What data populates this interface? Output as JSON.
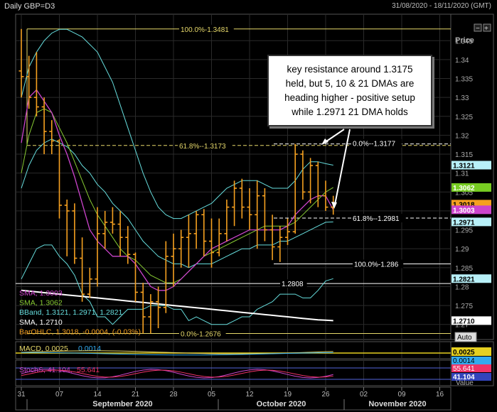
{
  "header": {
    "title": "Daily GBP=D3",
    "date_range": "31/08/2020 - 18/11/2020 (GMT)"
  },
  "toolbar": {
    "collapse_label": "−",
    "expand_label": "+",
    "auto_label": "Auto"
  },
  "colors": {
    "bar": "#f5a020",
    "sma5": "#cc44cc",
    "sma10": "#88cc33",
    "bband": "#66dddd",
    "sma_white": "#ffffff",
    "fib": "#e6d86a",
    "grid": "#2a2a2a",
    "bg": "#000000"
  },
  "annotation": {
    "lines": [
      "key resistance around 1.3175",
      "held, but 5, 10 & 21 DMAs are",
      "heading higher - positive setup",
      "while 1.2971 21 DMA holds"
    ]
  },
  "fib_labels": {
    "f100": "100.0%-1.3481",
    "f618": "61.8%--1.3173",
    "f0": "0.0%-1.2676",
    "r0": "0.0%--1.3177",
    "r618": "61.8%--1.2981",
    "r100": "100.0%-1.286",
    "support": "1.2808"
  },
  "chart_data": [
    {
      "type": "ohlc",
      "title": "Daily GBP=D3",
      "ylabel": "Price",
      "ylim": [
        1.266,
        1.352
      ],
      "yticks": [
        "1.345",
        "1.34",
        "1.335",
        "1.33",
        "1.325",
        "1.32",
        "1.315",
        "1.31",
        "1.305",
        "1.3",
        "1.295",
        "1.29",
        "1.285",
        "1.28",
        "1.275",
        "1.27"
      ],
      "xticks": [
        "31",
        "07",
        "14",
        "21",
        "28",
        "05",
        "12",
        "19",
        "26",
        "02",
        "09",
        "16"
      ],
      "months": [
        "September 2020",
        "October 2020",
        "November 2020"
      ],
      "ohlc": [
        {
          "o": 1.337,
          "h": 1.3481,
          "l": 1.33,
          "c": 1.3355
        },
        {
          "o": 1.3355,
          "h": 1.341,
          "l": 1.327,
          "c": 1.33
        },
        {
          "o": 1.33,
          "h": 1.342,
          "l": 1.325,
          "c": 1.3275
        },
        {
          "o": 1.3275,
          "h": 1.33,
          "l": 1.315,
          "c": 1.321
        },
        {
          "o": 1.321,
          "h": 1.324,
          "l": 1.315,
          "c": 1.3185
        },
        {
          "o": 1.3185,
          "h": 1.319,
          "l": 1.298,
          "c": 1.3015
        },
        {
          "o": 1.3015,
          "h": 1.303,
          "l": 1.288,
          "c": 1.3
        },
        {
          "o": 1.3,
          "h": 1.302,
          "l": 1.286,
          "c": 1.2875
        },
        {
          "o": 1.2875,
          "h": 1.293,
          "l": 1.276,
          "c": 1.278
        },
        {
          "o": 1.278,
          "h": 1.285,
          "l": 1.277,
          "c": 1.282
        },
        {
          "o": 1.282,
          "h": 1.301,
          "l": 1.28,
          "c": 1.294
        },
        {
          "o": 1.294,
          "h": 1.3,
          "l": 1.29,
          "c": 1.297
        },
        {
          "o": 1.297,
          "h": 1.301,
          "l": 1.294,
          "c": 1.2965
        },
        {
          "o": 1.2965,
          "h": 1.3,
          "l": 1.288,
          "c": 1.293
        },
        {
          "o": 1.293,
          "h": 1.296,
          "l": 1.286,
          "c": 1.2885
        },
        {
          "o": 1.2885,
          "h": 1.289,
          "l": 1.276,
          "c": 1.2785
        },
        {
          "o": 1.2785,
          "h": 1.281,
          "l": 1.2676,
          "c": 1.272
        },
        {
          "o": 1.272,
          "h": 1.278,
          "l": 1.2676,
          "c": 1.276
        },
        {
          "o": 1.276,
          "h": 1.28,
          "l": 1.269,
          "c": 1.2745
        },
        {
          "o": 1.2745,
          "h": 1.292,
          "l": 1.273,
          "c": 1.288
        },
        {
          "o": 1.288,
          "h": 1.294,
          "l": 1.28,
          "c": 1.29
        },
        {
          "o": 1.29,
          "h": 1.295,
          "l": 1.285,
          "c": 1.293
        },
        {
          "o": 1.293,
          "h": 1.299,
          "l": 1.285,
          "c": 1.294
        },
        {
          "o": 1.294,
          "h": 1.3,
          "l": 1.29,
          "c": 1.299
        },
        {
          "o": 1.299,
          "h": 1.3005,
          "l": 1.288,
          "c": 1.292
        },
        {
          "o": 1.292,
          "h": 1.298,
          "l": 1.285,
          "c": 1.289
        },
        {
          "o": 1.289,
          "h": 1.298,
          "l": 1.288,
          "c": 1.294
        },
        {
          "o": 1.294,
          "h": 1.303,
          "l": 1.292,
          "c": 1.301
        },
        {
          "o": 1.301,
          "h": 1.308,
          "l": 1.296,
          "c": 1.306
        },
        {
          "o": 1.306,
          "h": 1.3085,
          "l": 1.298,
          "c": 1.301
        },
        {
          "o": 1.301,
          "h": 1.306,
          "l": 1.295,
          "c": 1.299
        },
        {
          "o": 1.299,
          "h": 1.308,
          "l": 1.29,
          "c": 1.304
        },
        {
          "o": 1.304,
          "h": 1.306,
          "l": 1.292,
          "c": 1.295
        },
        {
          "o": 1.295,
          "h": 1.299,
          "l": 1.287,
          "c": 1.2905
        },
        {
          "o": 1.2905,
          "h": 1.296,
          "l": 1.2865,
          "c": 1.293
        },
        {
          "o": 1.293,
          "h": 1.298,
          "l": 1.291,
          "c": 1.2945
        },
        {
          "o": 1.2945,
          "h": 1.3177,
          "l": 1.294,
          "c": 1.315
        },
        {
          "o": 1.315,
          "h": 1.316,
          "l": 1.303,
          "c": 1.305
        },
        {
          "o": 1.305,
          "h": 1.314,
          "l": 1.302,
          "c": 1.312
        },
        {
          "o": 1.312,
          "h": 1.313,
          "l": 1.301,
          "c": 1.304
        },
        {
          "o": 1.304,
          "h": 1.308,
          "l": 1.3,
          "c": 1.301
        },
        {
          "o": 1.301,
          "h": 1.304,
          "l": 1.299,
          "c": 1.3018
        }
      ],
      "overlays": {
        "sma5": [
          1.318,
          1.33,
          1.332,
          1.329,
          1.326,
          1.32,
          1.315,
          1.309,
          1.302,
          1.295,
          1.292,
          1.29,
          1.288,
          1.288,
          1.288,
          1.286,
          1.283,
          1.28,
          1.279,
          1.279,
          1.28,
          1.282,
          1.284,
          1.286,
          1.288,
          1.29,
          1.291,
          1.292,
          1.293,
          1.294,
          1.295,
          1.295,
          1.295,
          1.295,
          1.295,
          1.296,
          1.299,
          1.301,
          1.303,
          1.304,
          1.304,
          1.3003
        ],
        "sma10": [
          1.31,
          1.32,
          1.326,
          1.327,
          1.326,
          1.322,
          1.318,
          1.313,
          1.308,
          1.303,
          1.299,
          1.296,
          1.293,
          1.29,
          1.288,
          1.287,
          1.285,
          1.283,
          1.282,
          1.281,
          1.281,
          1.282,
          1.284,
          1.286,
          1.288,
          1.289,
          1.29,
          1.291,
          1.292,
          1.293,
          1.294,
          1.295,
          1.296,
          1.296,
          1.296,
          1.296,
          1.297,
          1.299,
          1.301,
          1.303,
          1.305,
          1.3062
        ],
        "bband_mid": [
          1.306,
          1.312,
          1.316,
          1.318,
          1.319,
          1.318,
          1.317,
          1.315,
          1.312,
          1.31,
          1.307,
          1.305,
          1.302,
          1.3,
          1.298,
          1.295,
          1.292,
          1.29,
          1.288,
          1.287,
          1.286,
          1.286,
          1.285,
          1.286,
          1.286,
          1.286,
          1.287,
          1.288,
          1.289,
          1.29,
          1.29,
          1.291,
          1.291,
          1.291,
          1.292,
          1.292,
          1.293,
          1.294,
          1.295,
          1.296,
          1.297,
          1.2971
        ],
        "bband_up": [
          1.33,
          1.338,
          1.342,
          1.345,
          1.347,
          1.348,
          1.348,
          1.347,
          1.346,
          1.344,
          1.342,
          1.338,
          1.334,
          1.328,
          1.322,
          1.316,
          1.31,
          1.305,
          1.301,
          1.299,
          1.298,
          1.298,
          1.299,
          1.3,
          1.301,
          1.302,
          1.304,
          1.306,
          1.307,
          1.308,
          1.308,
          1.308,
          1.307,
          1.306,
          1.306,
          1.306,
          1.308,
          1.311,
          1.313,
          1.313,
          1.3125,
          1.3121
        ],
        "bband_lo": [
          1.282,
          1.286,
          1.29,
          1.291,
          1.291,
          1.288,
          1.286,
          1.283,
          1.278,
          1.276,
          1.272,
          1.272,
          1.27,
          1.272,
          1.274,
          1.274,
          1.274,
          1.275,
          1.275,
          1.275,
          1.274,
          1.274,
          1.271,
          1.272,
          1.271,
          1.27,
          1.27,
          1.27,
          1.271,
          1.272,
          1.272,
          1.274,
          1.275,
          1.276,
          1.278,
          1.278,
          1.278,
          1.277,
          1.277,
          1.279,
          1.2815,
          1.2821
        ],
        "sma_white": [
          1.279,
          1.2788,
          1.2786,
          1.2784,
          1.2782,
          1.278,
          1.2778,
          1.2776,
          1.2774,
          1.2772,
          1.277,
          1.2768,
          1.2766,
          1.2764,
          1.2762,
          1.276,
          1.2758,
          1.2756,
          1.2754,
          1.2752,
          1.275,
          1.2748,
          1.2746,
          1.2744,
          1.2742,
          1.274,
          1.2738,
          1.2736,
          1.2734,
          1.2732,
          1.273,
          1.2728,
          1.2726,
          1.2724,
          1.2722,
          1.272,
          1.2718,
          1.2716,
          1.2714,
          1.2712,
          1.2711,
          1.271
        ]
      },
      "legend": [
        {
          "label": "SMA, 1.3003",
          "color": "#cc44cc"
        },
        {
          "label": "SMA, 1.3062",
          "color": "#88cc33"
        },
        {
          "label": "BBand, 1.3121, 1.2971, 1.2821",
          "color": "#66dddd"
        },
        {
          "label": "SMA, 1.2710",
          "color": "#ffffff"
        },
        {
          "label": "BarOHLC, 1.3018, -0.0004, (-0.03%)",
          "color": "#f5a020"
        }
      ],
      "price_tags": [
        {
          "text": "1.3121",
          "value": 1.3121,
          "bg": "#b8f0f8",
          "fg": "#000"
        },
        {
          "text": "1.3062",
          "value": 1.3062,
          "bg": "#77cc22",
          "fg": "#fff"
        },
        {
          "text": "1.3018",
          "value": 1.3018,
          "bg": "#f5a020",
          "fg": "#000"
        },
        {
          "text": "1.3003",
          "value": 1.3003,
          "bg": "#cc44cc",
          "fg": "#fff"
        },
        {
          "text": "1.2971",
          "value": 1.2971,
          "bg": "#b8f0f8",
          "fg": "#000"
        },
        {
          "text": "1.2821",
          "value": 1.2821,
          "bg": "#b8f0f8",
          "fg": "#000"
        },
        {
          "text": "1.2710",
          "value": 1.271,
          "bg": "#ffffff",
          "fg": "#000"
        }
      ]
    },
    {
      "type": "line",
      "title": "MACD",
      "legend": [
        {
          "label": "MACD, 0.0025",
          "color": "#e6d86a"
        },
        {
          "label": "0.0014",
          "color": "#33aaee"
        }
      ],
      "price_tags": [
        {
          "text": "0.0025",
          "bg": "#e6d020",
          "fg": "#000"
        },
        {
          "text": "0.0014",
          "bg": "#33aaee",
          "fg": "#000"
        }
      ]
    },
    {
      "type": "line",
      "title": "StochS",
      "legend": [
        {
          "label": "StochS, 41.104,",
          "color": "#cc44cc"
        },
        {
          "label": "55.641",
          "color": "#ee3366"
        }
      ],
      "price_tags": [
        {
          "text": "55.641",
          "bg": "#ee3366",
          "fg": "#fff"
        },
        {
          "text": "41.104",
          "bg": "#3344bb",
          "fg": "#fff"
        }
      ],
      "ylabel": "Value"
    }
  ]
}
